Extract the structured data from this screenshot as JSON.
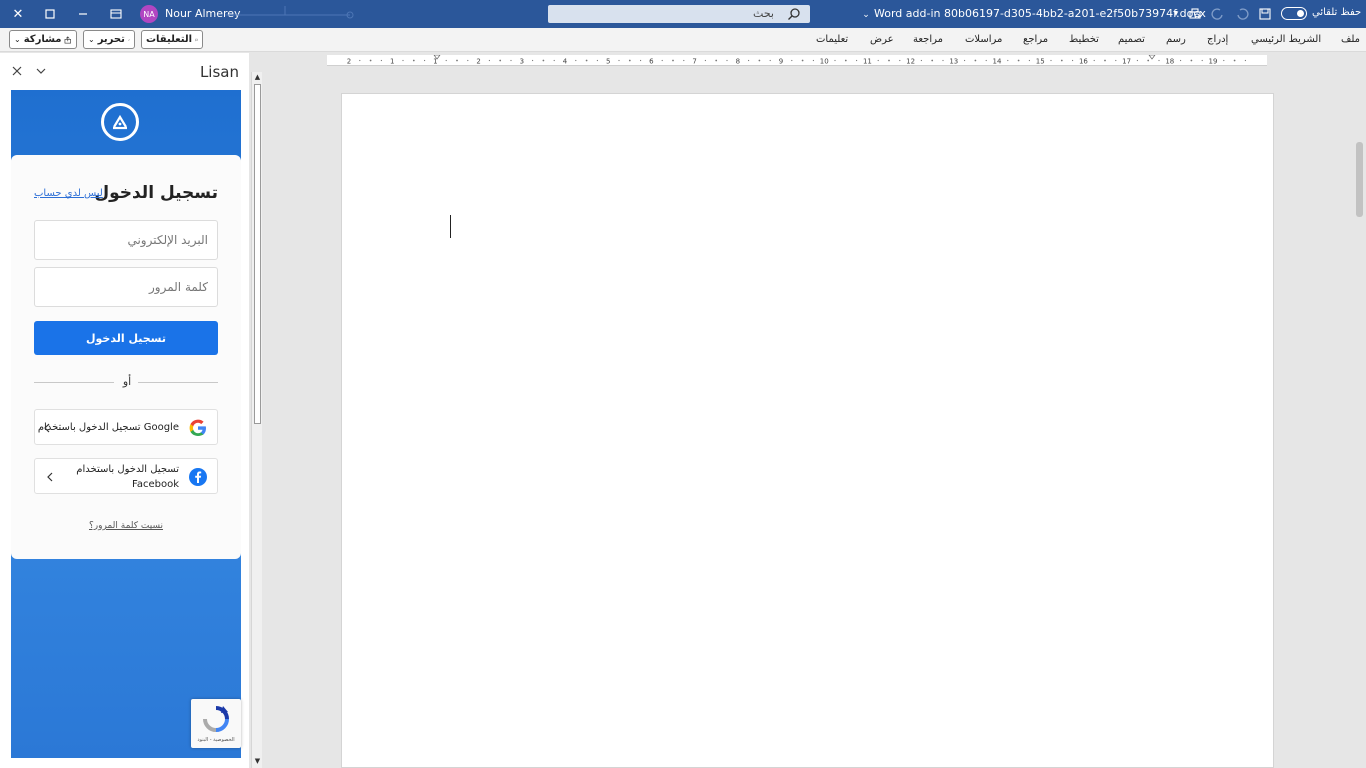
{
  "titlebar": {
    "user_initials": "NA",
    "user_name": "Nour Almerey",
    "search_placeholder": "بحث",
    "document_title": "Word add-in 80b06197-d305-4bb2-a201-e2f50b73974f.docx",
    "autosave_label": "حفظ تلقائي",
    "autosave_on": true,
    "accent_color": "#2b579a"
  },
  "ribbon": {
    "share_label": "مشاركة",
    "edit_label": "تحرير",
    "comments_label": "التعليقات",
    "tabs": [
      "ملف",
      "الشريط الرئيسي",
      "إدراج",
      "رسم",
      "تصميم",
      "تخطيط",
      "مراجع",
      "مراسلات",
      "مراجعة",
      "عرض",
      "تعليمات"
    ]
  },
  "ruler": {
    "numbers": [
      "2",
      "1",
      "1",
      "2",
      "3",
      "4",
      "5",
      "6",
      "7",
      "8",
      "9",
      "10",
      "11",
      "12",
      "13",
      "14",
      "15",
      "16",
      "17",
      "18",
      "19"
    ]
  },
  "pane": {
    "title": "Lisan",
    "login": {
      "title": "تسجيل الدخول",
      "no_account_link": "ليس لدي حساب",
      "email_placeholder": "البريد الإلكتروني",
      "password_placeholder": "كلمة المرور",
      "submit_label": "تسجيل الدخول",
      "divider_text": "أو",
      "google_label": "تسجيل الدخول باستخدام Google",
      "facebook_label_line1": "تسجيل الدخول باستخدام",
      "facebook_label_line2": "Facebook",
      "forgot_link": "نسيت كلمة المرور؟",
      "brand_color": "#1a73e8"
    },
    "recaptcha_footer": "الخصوصية - البنود"
  }
}
